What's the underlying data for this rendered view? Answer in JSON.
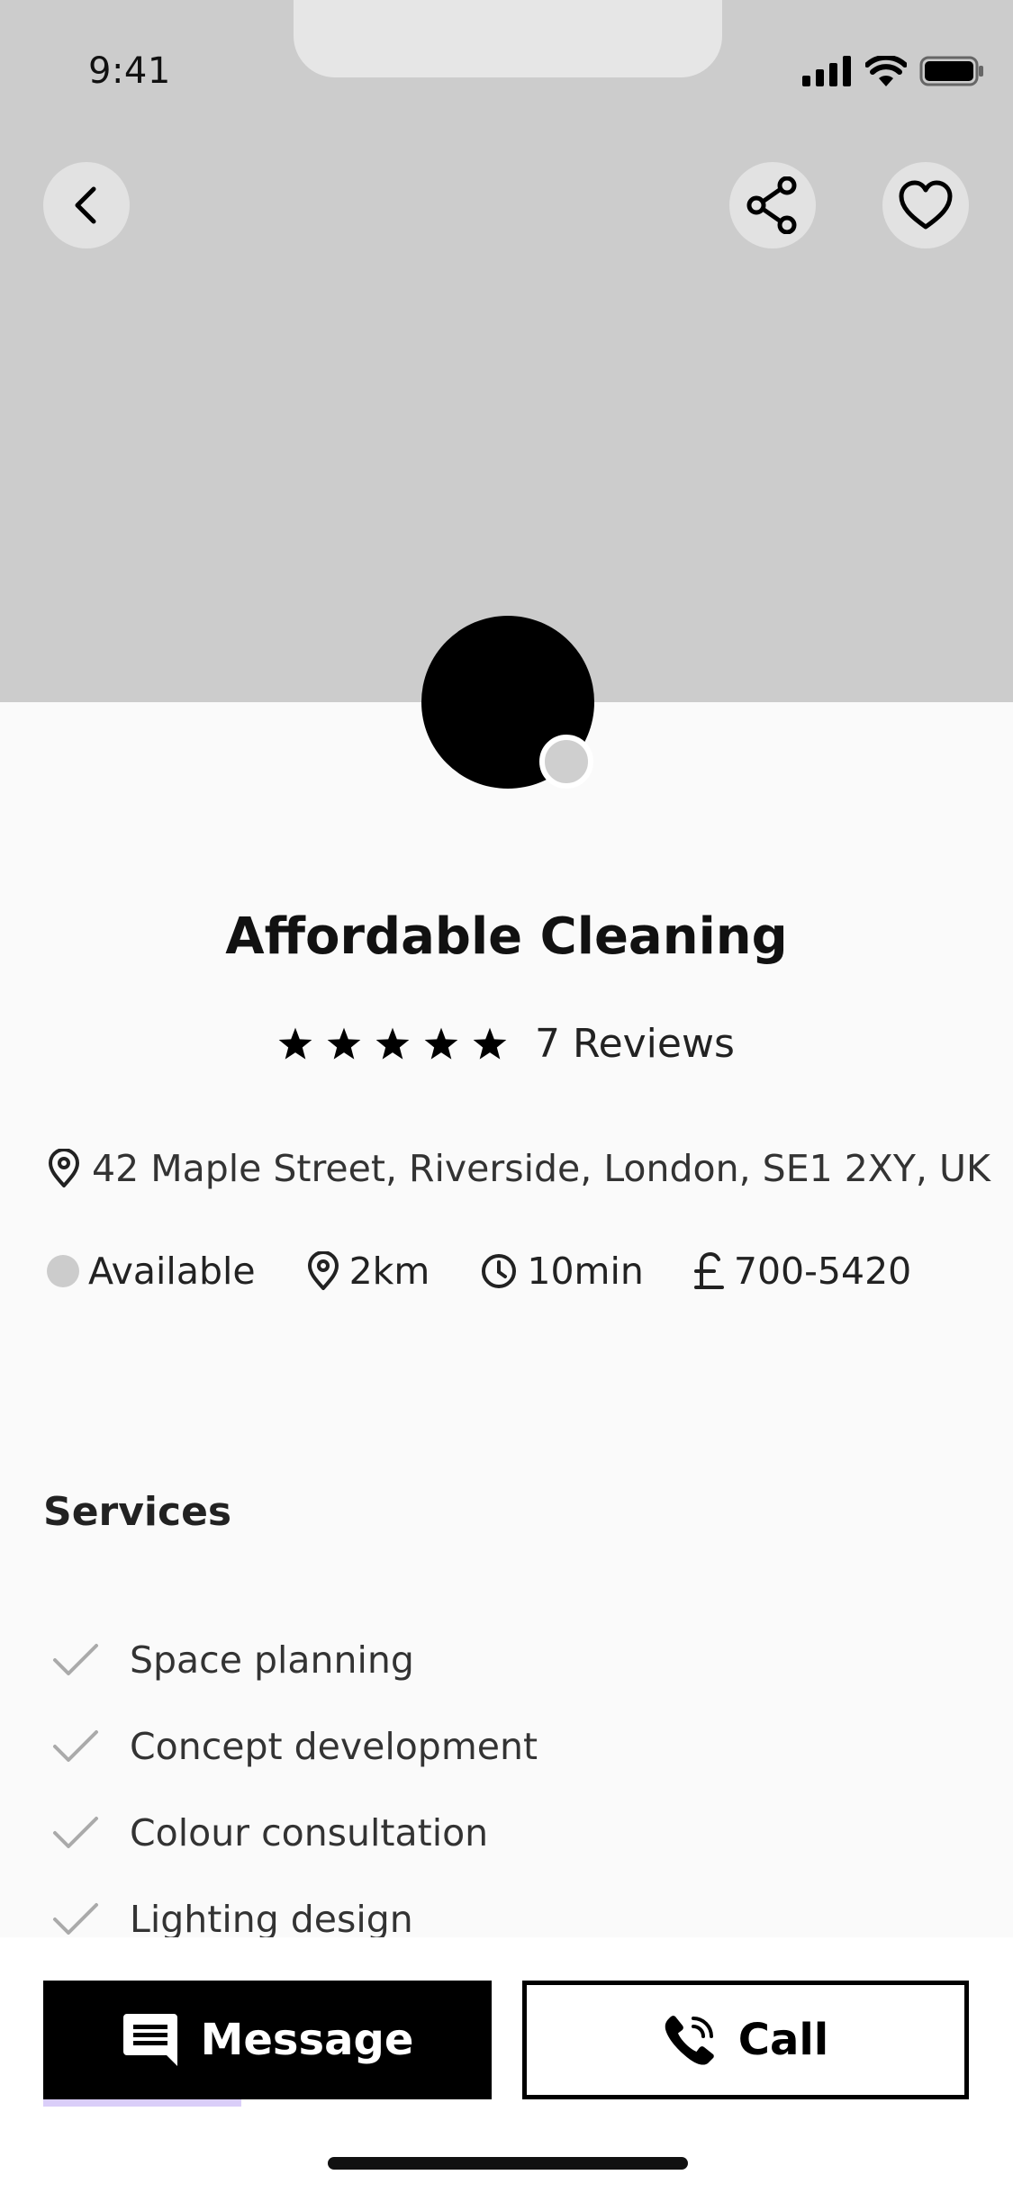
{
  "status_bar": {
    "time": "9:41"
  },
  "header": {
    "back_icon": "chevron-left-icon",
    "share_icon": "share-icon",
    "favorite_icon": "heart-icon"
  },
  "business": {
    "name": "Affordable Cleaning",
    "rating_stars": 5,
    "reviews_label": "7 Reviews",
    "address": "42 Maple Street, Riverside, London, SE1 2XY, UK",
    "availability": "Available",
    "distance": "2km",
    "time": "10min",
    "phone": "700-5420"
  },
  "services": {
    "title": "Services",
    "items": [
      "Space planning",
      "Concept development",
      "Colour consultation",
      "Lighting design"
    ]
  },
  "actions": {
    "message_label": "Message",
    "call_label": "Call"
  },
  "colors": {
    "hero_background": "#cccccc",
    "page_background": "#fafafa",
    "primary": "#000000"
  }
}
